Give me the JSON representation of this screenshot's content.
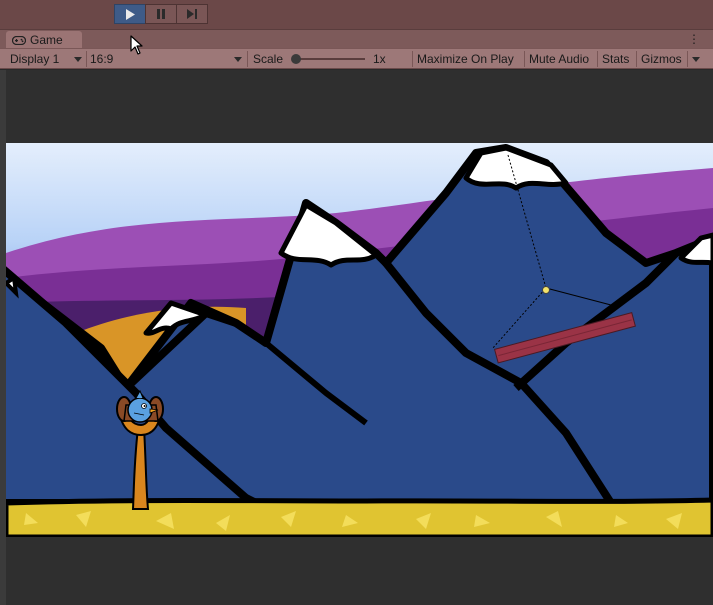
{
  "toolbar": {
    "play_icon": "play-icon",
    "pause_icon": "pause-icon",
    "step_icon": "step-icon",
    "accent_color": "#3e5b88"
  },
  "tab": {
    "icon": "gamepad-icon",
    "label": "Game"
  },
  "game_bar": {
    "display": "Display 1",
    "aspect": "16:9",
    "scale_label": "Scale",
    "scale_value": "1x",
    "maximize": "Maximize On Play",
    "mute": "Mute Audio",
    "stats": "Stats",
    "gizmos": "Gizmos"
  },
  "scene": {
    "sky_color": "#b9d3f7",
    "mountain_color": "#2a4a8a",
    "ground_color": "#e0c431",
    "plank_color": "#9a3346",
    "bird_color": "#5aa0e0"
  }
}
